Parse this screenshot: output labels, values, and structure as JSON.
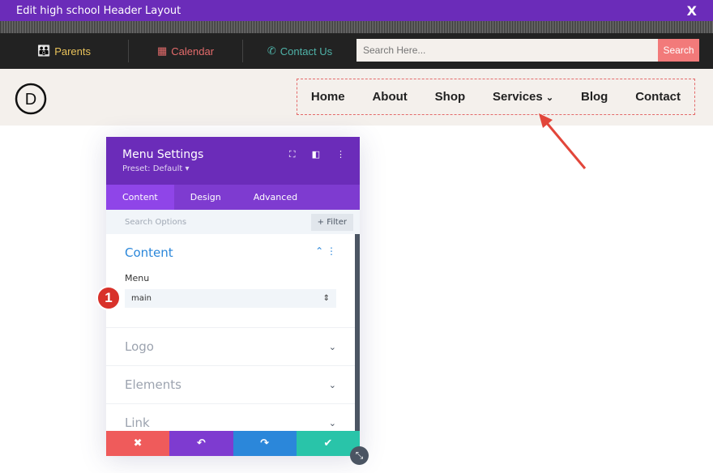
{
  "window": {
    "title": "Edit high school Header Layout",
    "close": "X"
  },
  "utility": {
    "links": [
      {
        "label": "Parents",
        "icon": "👪",
        "color": "#e8c25a"
      },
      {
        "label": "Calendar",
        "icon": "▦",
        "color": "#e46b6b"
      },
      {
        "label": "Contact Us",
        "icon": "✆",
        "color": "#4fb3a9"
      }
    ],
    "search_placeholder": "Search Here...",
    "search_button": "Search"
  },
  "header": {
    "logo": "D",
    "menu": [
      "Home",
      "About",
      "Shop",
      "Services",
      "Blog",
      "Contact"
    ],
    "services_chevron": "⌄"
  },
  "panel": {
    "title": "Menu Settings",
    "preset": "Preset: Default ▾",
    "tabs": [
      "Content",
      "Design",
      "Advanced"
    ],
    "search_placeholder": "Search Options",
    "filter": "+ Filter",
    "open_section": {
      "title": "Content",
      "field_label": "Menu",
      "field_value": "main"
    },
    "sections": [
      "Logo",
      "Elements",
      "Link"
    ],
    "footer": {
      "cancel": "✖",
      "undo": "↶",
      "redo": "↷",
      "save": "✔"
    }
  },
  "badge": "1"
}
